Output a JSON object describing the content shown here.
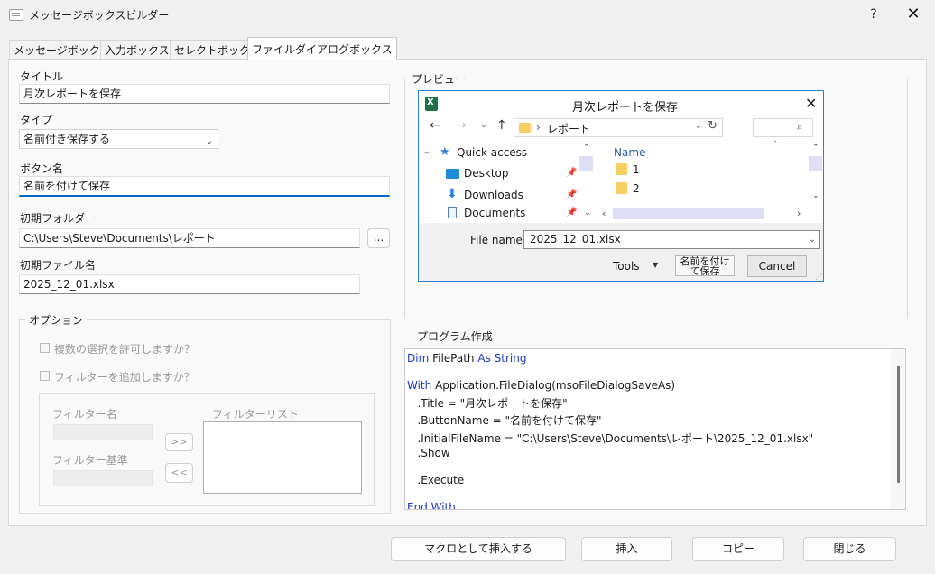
{
  "window": {
    "title": "メッセージボックスビルダー",
    "help": "?",
    "close": "✕"
  },
  "tabs": [
    "メッセージボックス",
    "入力ボックス",
    "セレクトボックス",
    "ファイルダイアログボックス"
  ],
  "form": {
    "title_label": "タイトル",
    "title_value": "月次レポートを保存",
    "type_label": "タイプ",
    "type_value": "名前付き保存する",
    "button_label": "ボタン名",
    "button_value": "名前を付けて保存",
    "folder_label": "初期フォルダー",
    "folder_value": "C:\\Users\\Steve\\Documents\\レポート",
    "browse": "...",
    "file_label": "初期ファイル名",
    "file_value": "2025_12_01.xlsx"
  },
  "options": {
    "legend": "オプション",
    "multi": "複数の選択を許可しますか？",
    "filter": "フィルターを追加しますか？",
    "filter_name": "フィルター名",
    "filter_criteria": "フィルター基準",
    "filter_list": "フィルターリスト",
    "add": ">>",
    "remove": "<<"
  },
  "preview": {
    "legend": "プレビュー",
    "title": "月次レポートを保存",
    "path": "レポート",
    "quick_access": "Quick access",
    "nav_items": [
      "Desktop",
      "Downloads",
      "Documents"
    ],
    "name_header": "Name",
    "files": [
      "1",
      "2"
    ],
    "file_name_label": "File name:",
    "file_name_value": "2025_12_01.xlsx",
    "tools": "Tools",
    "save_button": "名前を付けて保存",
    "cancel": "Cancel"
  },
  "program": {
    "legend": "プログラム作成",
    "lines": [
      {
        "kw": "Dim",
        "rest": " FilePath ",
        "kw2": "As String"
      },
      {
        "kw": "With",
        "rest": " Application.FileDialog(msoFileDialogSaveAs)"
      },
      {
        "rest": "   .Title = \"月次レポートを保存\""
      },
      {
        "rest": "   .ButtonName = \"名前を付けて保存\""
      },
      {
        "rest": "   .InitialFileName = \"C:\\Users\\Steve\\Documents\\レポート\\2025_12_01.xlsx\""
      },
      {
        "rest": "   .Show"
      },
      {
        "rest": "   .Execute"
      },
      {
        "kw": "End With",
        "rest": ""
      }
    ]
  },
  "footer": {
    "macro": "マクロとして挿入する",
    "insert": "挿入",
    "copy": "コピー",
    "close": "閉じる"
  },
  "colors": {
    "accent": "#0067c0",
    "keyword": "#1a35c7",
    "dialog_border": "#2c7fd0"
  }
}
